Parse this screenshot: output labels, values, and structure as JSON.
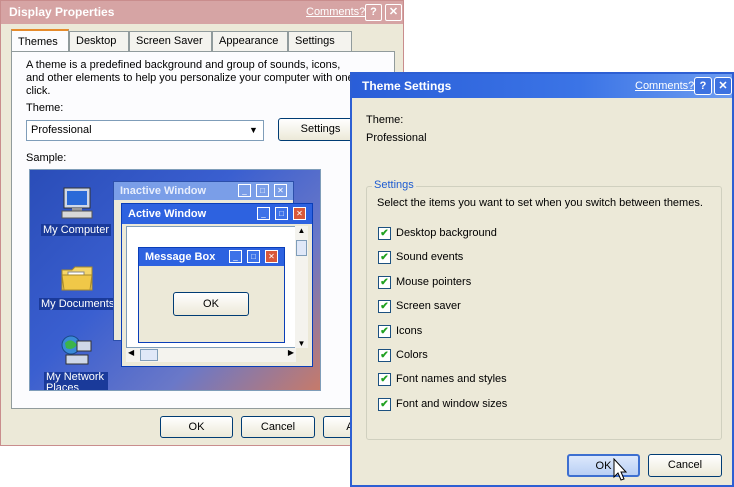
{
  "display_properties": {
    "title": "Display Properties",
    "comments_link": "Comments?",
    "help_glyph": "?",
    "close_glyph": "✕",
    "tabs": [
      "Themes",
      "Desktop",
      "Screen Saver",
      "Appearance",
      "Settings"
    ],
    "description": "A theme is a predefined background and group of sounds, icons, and other elements to help you personalize your computer with one click.",
    "theme_label": "Theme:",
    "theme_value": "Professional",
    "settings_button": "Settings",
    "sample_label": "Sample:",
    "desktop_icons": [
      "My Computer",
      "My Documents",
      "My Network Places"
    ],
    "inactive_window_title": "Inactive Window",
    "active_window_title": "Active Window",
    "message_box_title": "Message Box",
    "message_box_ok": "OK",
    "buttons": {
      "ok": "OK",
      "cancel": "Cancel",
      "apply": "Apply"
    }
  },
  "theme_settings": {
    "title": "Theme Settings",
    "comments_link": "Comments?",
    "help_glyph": "?",
    "close_glyph": "✕",
    "theme_label": "Theme:",
    "theme_value": "Professional",
    "group_title": "Settings",
    "instruction": "Select the items you want to set when you switch between themes.",
    "items": [
      {
        "label": "Desktop background",
        "checked": true
      },
      {
        "label": "Sound events",
        "checked": true
      },
      {
        "label": "Mouse pointers",
        "checked": true
      },
      {
        "label": "Screen saver",
        "checked": true
      },
      {
        "label": "Icons",
        "checked": true
      },
      {
        "label": "Colors",
        "checked": true
      },
      {
        "label": "Font names and styles",
        "checked": true
      },
      {
        "label": "Font and window sizes",
        "checked": true
      }
    ],
    "ok_button": "OK",
    "cancel_button": "Cancel"
  },
  "colors": {
    "xp_blue": "#2a5ed8",
    "inactive_title": "#d6a4a4",
    "dialog_face": "#ece9d8"
  }
}
